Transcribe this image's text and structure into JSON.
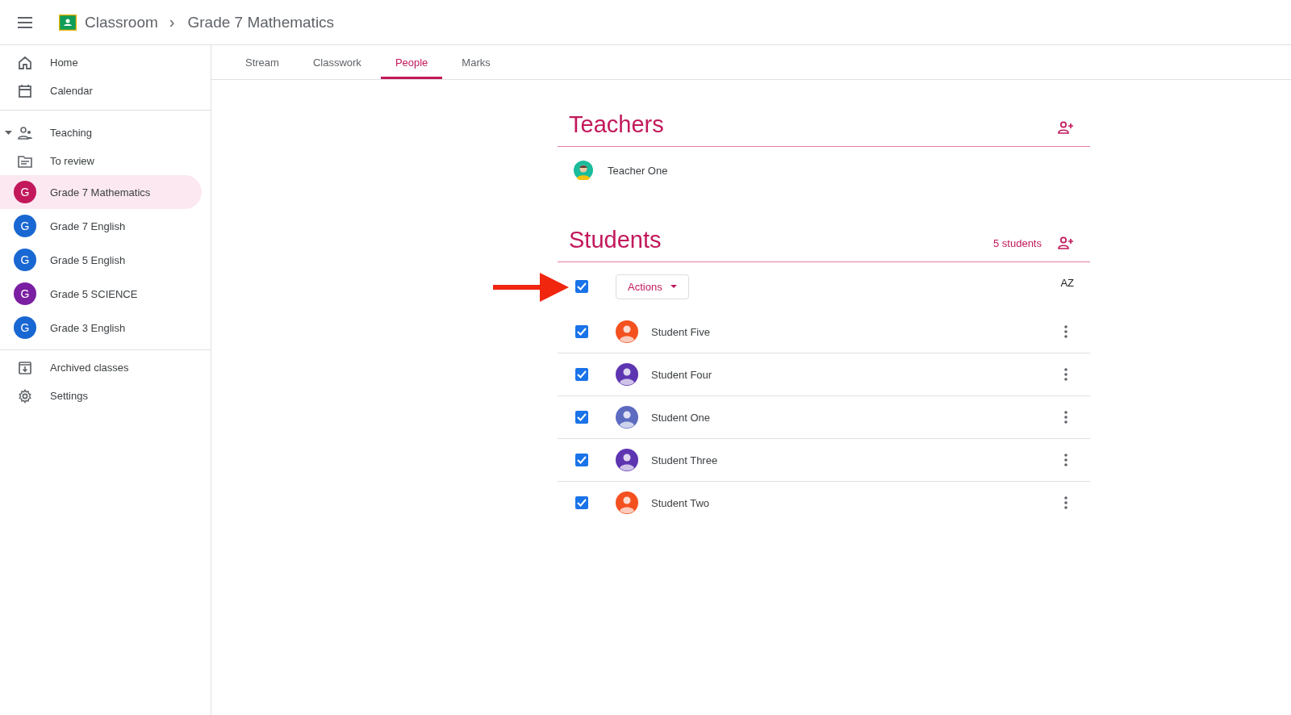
{
  "header": {
    "app_name": "Classroom",
    "separator": "›",
    "class_name": "Grade 7 Mathematics"
  },
  "sidebar": {
    "top": [
      {
        "label": "Home"
      },
      {
        "label": "Calendar"
      }
    ],
    "teaching": {
      "label": "Teaching",
      "expanded": true,
      "to_review": "To review",
      "classes": [
        {
          "letter": "G",
          "label": "Grade 7 Mathematics",
          "color": "#c2185b",
          "selected": true
        },
        {
          "letter": "G",
          "label": "Grade 7 English",
          "color": "#1967d2",
          "selected": false
        },
        {
          "letter": "G",
          "label": "Grade 5 English",
          "color": "#1967d2",
          "selected": false
        },
        {
          "letter": "G",
          "label": "Grade 5 SCIENCE",
          "color": "#7b1fa2",
          "selected": false
        },
        {
          "letter": "G",
          "label": "Grade 3 English",
          "color": "#1967d2",
          "selected": false
        }
      ]
    },
    "bottom": [
      {
        "label": "Archived classes"
      },
      {
        "label": "Settings"
      }
    ]
  },
  "tabs": [
    {
      "label": "Stream",
      "selected": false
    },
    {
      "label": "Classwork",
      "selected": false
    },
    {
      "label": "People",
      "selected": true
    },
    {
      "label": "Marks",
      "selected": false
    }
  ],
  "teachers": {
    "title": "Teachers",
    "people": [
      {
        "name": "Teacher One"
      }
    ]
  },
  "students": {
    "title": "Students",
    "count": "5 students",
    "select_all_checked": true,
    "actions_label": "Actions",
    "sort_label": "AZ",
    "people": [
      {
        "name": "Student Five",
        "checked": true,
        "color": "#f4511e"
      },
      {
        "name": "Student Four",
        "checked": true,
        "color": "#5e35b1"
      },
      {
        "name": "Student One",
        "checked": true,
        "color": "#5c6bc0"
      },
      {
        "name": "Student Three",
        "checked": true,
        "color": "#5e35b1"
      },
      {
        "name": "Student Two",
        "checked": true,
        "color": "#f4511e"
      }
    ]
  }
}
